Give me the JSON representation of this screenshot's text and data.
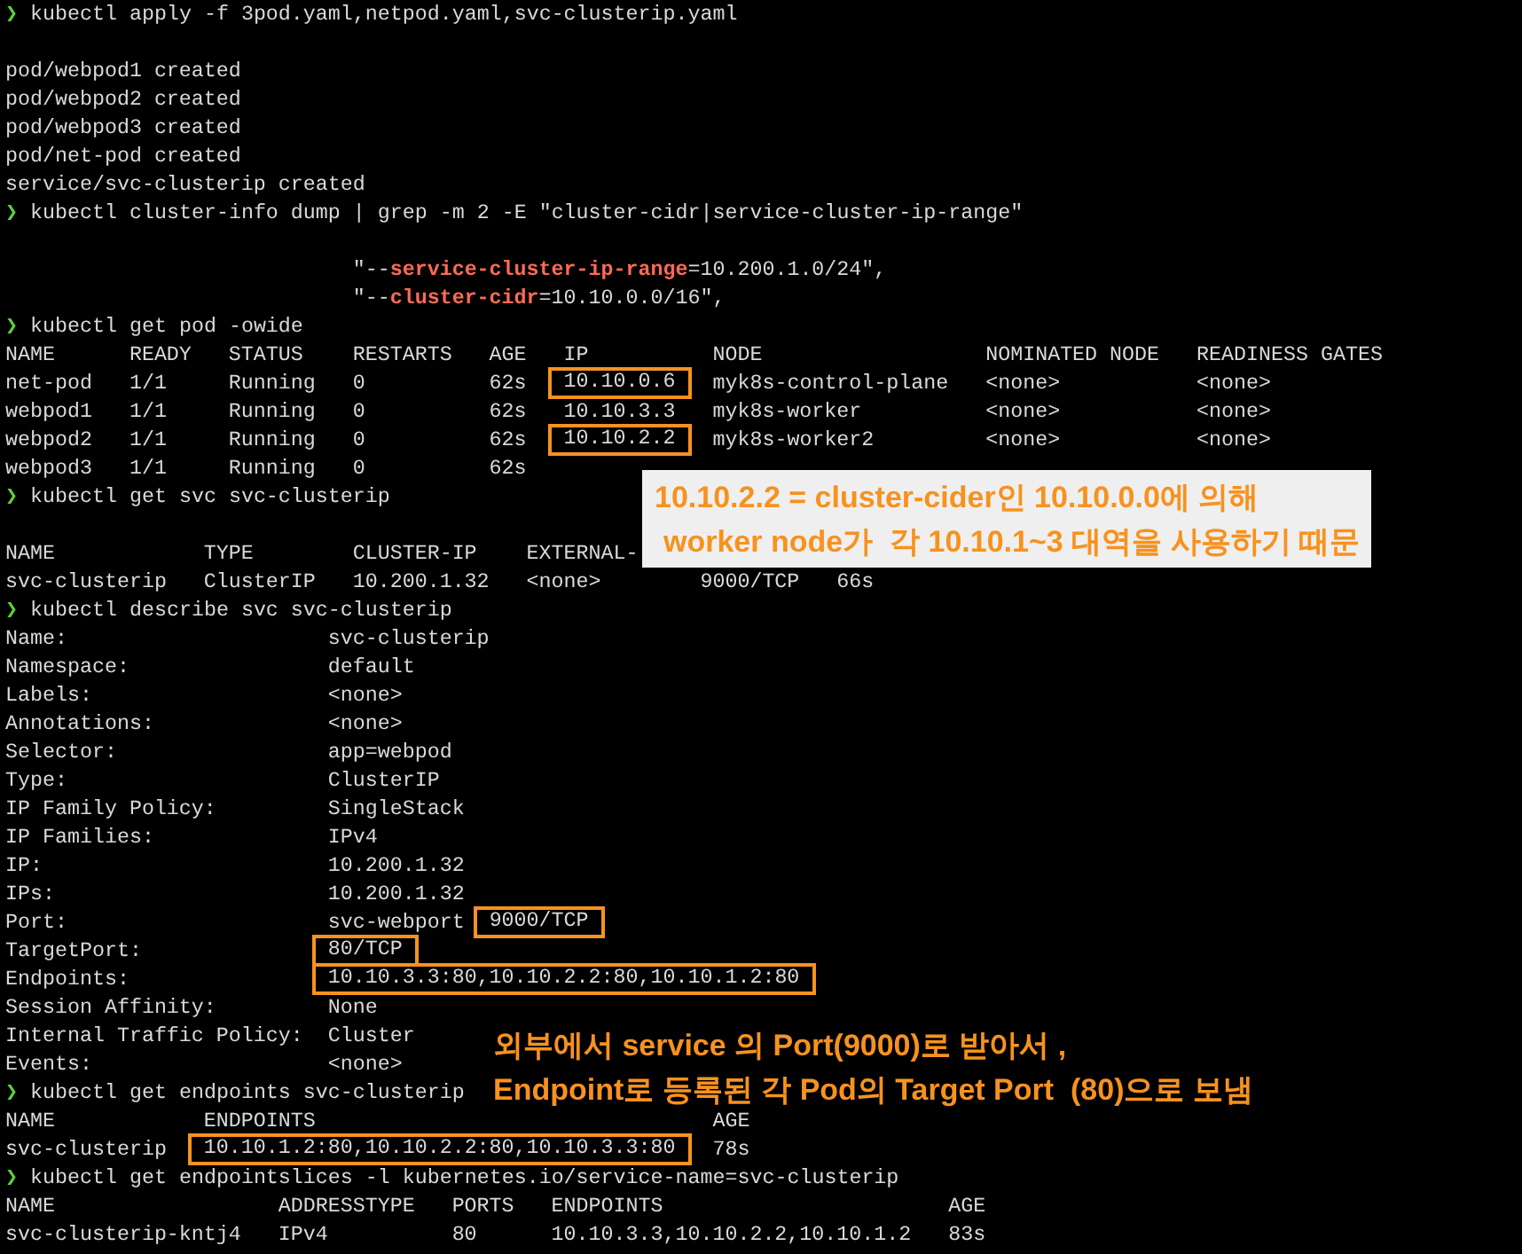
{
  "terminal": {
    "lines": [
      {
        "kind": "command",
        "prompt": "❯",
        "parts": [
          {
            "text": "kubectl apply -f 3pod.yaml,netpod.yaml,svc-clusterip.yaml",
            "kind": "plain"
          }
        ]
      },
      {
        "kind": "blank"
      },
      {
        "kind": "output",
        "parts": [
          {
            "text": "pod/webpod1 created",
            "kind": "plain"
          }
        ]
      },
      {
        "kind": "output",
        "parts": [
          {
            "text": "pod/webpod2 created",
            "kind": "plain"
          }
        ]
      },
      {
        "kind": "output",
        "parts": [
          {
            "text": "pod/webpod3 created",
            "kind": "plain"
          }
        ]
      },
      {
        "kind": "output",
        "parts": [
          {
            "text": "pod/net-pod created",
            "kind": "plain"
          }
        ]
      },
      {
        "kind": "output",
        "parts": [
          {
            "text": "service/svc-clusterip created",
            "kind": "plain"
          }
        ]
      },
      {
        "kind": "command",
        "prompt": "❯",
        "parts": [
          {
            "text": "kubectl cluster-info dump | grep -m 2 -E \"cluster-cidr|service-cluster-ip-range\"",
            "kind": "plain"
          }
        ]
      },
      {
        "kind": "blank"
      },
      {
        "kind": "output",
        "parts": [
          {
            "text": "                            \"--",
            "kind": "plain"
          },
          {
            "text": "service-cluster-ip-range",
            "kind": "flag"
          },
          {
            "text": "=10.200.1.0/24\",",
            "kind": "plain"
          }
        ]
      },
      {
        "kind": "output",
        "parts": [
          {
            "text": "                            \"--",
            "kind": "plain"
          },
          {
            "text": "cluster-cidr",
            "kind": "flag"
          },
          {
            "text": "=10.10.0.0/16\",",
            "kind": "plain"
          }
        ]
      },
      {
        "kind": "command",
        "prompt": "❯",
        "parts": [
          {
            "text": "kubectl get pod -owide",
            "kind": "plain"
          }
        ]
      },
      {
        "kind": "output",
        "parts": [
          {
            "text": "NAME      READY   STATUS    RESTARTS   AGE   IP          NODE                  NOMINATED NODE   READINESS GATES",
            "kind": "plain"
          }
        ]
      },
      {
        "kind": "output",
        "parts": [
          {
            "text": "net-pod   1/1     Running   0          62s   ",
            "kind": "plain"
          },
          {
            "text": "10.10.0.6",
            "kind": "boxed"
          },
          {
            "text": "   myk8s-control-plane   <none>           <none>",
            "kind": "plain"
          }
        ]
      },
      {
        "kind": "output",
        "parts": [
          {
            "text": "webpod1   1/1     Running   0          62s   10.10.3.3   myk8s-worker          <none>           <none>",
            "kind": "plain"
          }
        ]
      },
      {
        "kind": "output",
        "parts": [
          {
            "text": "webpod2   1/1     Running   0          62s   ",
            "kind": "plain"
          },
          {
            "text": "10.10.2.2",
            "kind": "boxed"
          },
          {
            "text": "   myk8s-worker2         <none>           <none>",
            "kind": "plain"
          }
        ]
      },
      {
        "kind": "output",
        "parts": [
          {
            "text": "webpod3   1/1     Running   0          62s",
            "kind": "plain"
          }
        ]
      },
      {
        "kind": "command",
        "prompt": "❯",
        "parts": [
          {
            "text": "kubectl get svc svc-clusterip",
            "kind": "plain"
          }
        ]
      },
      {
        "kind": "blank"
      },
      {
        "kind": "output",
        "parts": [
          {
            "text": "NAME            TYPE        CLUSTER-IP    EXTERNAL-",
            "kind": "plain"
          }
        ]
      },
      {
        "kind": "output",
        "parts": [
          {
            "text": "svc-clusterip   ClusterIP   10.200.1.32   <none>        9000/TCP   66s",
            "kind": "plain"
          }
        ]
      },
      {
        "kind": "command",
        "prompt": "❯",
        "parts": [
          {
            "text": "kubectl describe svc svc-clusterip",
            "kind": "plain"
          }
        ]
      },
      {
        "kind": "output",
        "parts": [
          {
            "text": "Name:                     svc-clusterip",
            "kind": "plain"
          }
        ]
      },
      {
        "kind": "output",
        "parts": [
          {
            "text": "Namespace:                default",
            "kind": "plain"
          }
        ]
      },
      {
        "kind": "output",
        "parts": [
          {
            "text": "Labels:                   <none>",
            "kind": "plain"
          }
        ]
      },
      {
        "kind": "output",
        "parts": [
          {
            "text": "Annotations:              <none>",
            "kind": "plain"
          }
        ]
      },
      {
        "kind": "output",
        "parts": [
          {
            "text": "Selector:                 app=webpod",
            "kind": "plain"
          }
        ]
      },
      {
        "kind": "output",
        "parts": [
          {
            "text": "Type:                     ClusterIP",
            "kind": "plain"
          }
        ]
      },
      {
        "kind": "output",
        "parts": [
          {
            "text": "IP Family Policy:         SingleStack",
            "kind": "plain"
          }
        ]
      },
      {
        "kind": "output",
        "parts": [
          {
            "text": "IP Families:              IPv4",
            "kind": "plain"
          }
        ]
      },
      {
        "kind": "output",
        "parts": [
          {
            "text": "IP:                       10.200.1.32",
            "kind": "plain"
          }
        ]
      },
      {
        "kind": "output",
        "parts": [
          {
            "text": "IPs:                      10.200.1.32",
            "kind": "plain"
          }
        ]
      },
      {
        "kind": "output",
        "parts": [
          {
            "text": "Port:                     svc-webport  ",
            "kind": "plain"
          },
          {
            "text": "9000/TCP",
            "kind": "boxed"
          }
        ]
      },
      {
        "kind": "output",
        "parts": [
          {
            "text": "TargetPort:               ",
            "kind": "plain"
          },
          {
            "text": "80/TCP",
            "kind": "boxed"
          }
        ]
      },
      {
        "kind": "output",
        "parts": [
          {
            "text": "Endpoints:                ",
            "kind": "plain"
          },
          {
            "text": "10.10.3.3:80,10.10.2.2:80,10.10.1.2:80",
            "kind": "boxed"
          }
        ]
      },
      {
        "kind": "output",
        "parts": [
          {
            "text": "Session Affinity:         None",
            "kind": "plain"
          }
        ]
      },
      {
        "kind": "output",
        "parts": [
          {
            "text": "Internal Traffic Policy:  Cluster",
            "kind": "plain"
          }
        ]
      },
      {
        "kind": "output",
        "parts": [
          {
            "text": "Events:                   <none>",
            "kind": "plain"
          }
        ]
      },
      {
        "kind": "command",
        "prompt": "❯",
        "parts": [
          {
            "text": "kubectl get endpoints svc-clusterip",
            "kind": "plain"
          }
        ]
      },
      {
        "kind": "output",
        "parts": [
          {
            "text": "NAME            ENDPOINTS                                AGE",
            "kind": "plain"
          }
        ]
      },
      {
        "kind": "output",
        "parts": [
          {
            "text": "svc-clusterip   ",
            "kind": "plain"
          },
          {
            "text": "10.10.1.2:80,10.10.2.2:80,10.10.3.3:80",
            "kind": "boxed"
          },
          {
            "text": "   78s",
            "kind": "plain"
          }
        ]
      },
      {
        "kind": "command",
        "prompt": "❯",
        "parts": [
          {
            "text": "kubectl get endpointslices -l kubernetes.io/service-name=svc-clusterip",
            "kind": "plain"
          }
        ]
      },
      {
        "kind": "output",
        "parts": [
          {
            "text": "NAME                  ADDRESSTYPE   PORTS   ENDPOINTS                       AGE",
            "kind": "plain"
          }
        ]
      },
      {
        "kind": "output",
        "parts": [
          {
            "text": "svc-clusterip-kntj4   IPv4          80      10.10.3.3,10.10.2.2,10.10.1.2   83s",
            "kind": "plain"
          }
        ]
      }
    ]
  },
  "callouts": [
    {
      "kind": "boxed",
      "lines": [
        "10.10.2.2 = cluster-cider인 10.10.0.0에 의해",
        "worker node가  각 10.10.1~3 대역을 사용하기 때문"
      ]
    },
    {
      "kind": "plain",
      "lines": [
        "외부에서 service 의 Port(9000)로 받아서 ,",
        "Endpoint로 등록된 각 Pod의 Target Port  (80)으로 보냄"
      ]
    }
  ]
}
